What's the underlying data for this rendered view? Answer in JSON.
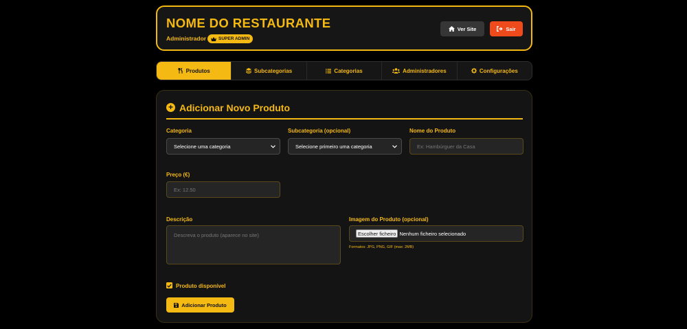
{
  "header": {
    "title": "NOME DO RESTAURANTE",
    "role": "Administrador",
    "badge": "SUPER ADMIN",
    "view_site": "Ver Site",
    "logout": "Sair"
  },
  "tabs": [
    {
      "label": "Produtos",
      "icon": "utensils-icon",
      "active": true
    },
    {
      "label": "Subcategorias",
      "icon": "layers-icon",
      "active": false
    },
    {
      "label": "Categorias",
      "icon": "list-icon",
      "active": false
    },
    {
      "label": "Administradores",
      "icon": "users-icon",
      "active": false
    },
    {
      "label": "Configurações",
      "icon": "gear-icon",
      "active": false
    }
  ],
  "form": {
    "title": "Adicionar Novo Produto",
    "category_label": "Categoria",
    "category_value": "Selecione uma categoria",
    "subcategory_label": "Subcategoria (opcional)",
    "subcategory_value": "Selecione primeiro uma categoria",
    "name_label": "Nome do Produto",
    "name_placeholder": "Ex: Hambúrguer da Casa",
    "price_label": "Preço (€)",
    "price_placeholder": "Ex: 12.50",
    "description_label": "Descrição",
    "description_placeholder": "Descreva o produto (aparece no site)",
    "image_label": "Imagem do Produto (opcional)",
    "file_button": "Escolher ficheiro",
    "file_status": "Nenhum ficheiro selecionado",
    "formats_hint": "Formatos: JPG, PNG, GIF (max: 2MB)",
    "available_label": "Produto disponível",
    "available_checked": true,
    "submit_label": "Adicionar Produto"
  },
  "colors": {
    "accent": "#f5b914",
    "danger": "#ef4a1c",
    "background": "#000000",
    "card": "#141414"
  }
}
